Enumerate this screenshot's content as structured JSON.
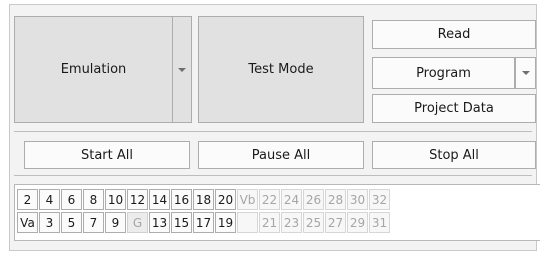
{
  "left_group": {
    "emulation_label": "Emulation",
    "test_mode_label": "Test Mode"
  },
  "right_group": {
    "read_label": "Read",
    "program_label": "Program",
    "project_data_label": "Project Data"
  },
  "actions": {
    "start_all_label": "Start All",
    "pause_all_label": "Pause All",
    "stop_all_label": "Stop All"
  },
  "pin_grid": {
    "row_top": [
      {
        "label": "2",
        "enabled": true
      },
      {
        "label": "4",
        "enabled": true
      },
      {
        "label": "6",
        "enabled": true
      },
      {
        "label": "8",
        "enabled": true
      },
      {
        "label": "10",
        "enabled": true
      },
      {
        "label": "12",
        "enabled": true
      },
      {
        "label": "14",
        "enabled": true
      },
      {
        "label": "16",
        "enabled": true
      },
      {
        "label": "18",
        "enabled": true
      },
      {
        "label": "20",
        "enabled": true
      },
      {
        "label": "Vb",
        "enabled": false
      },
      {
        "label": "22",
        "enabled": false
      },
      {
        "label": "24",
        "enabled": false
      },
      {
        "label": "26",
        "enabled": false
      },
      {
        "label": "28",
        "enabled": false
      },
      {
        "label": "30",
        "enabled": false
      },
      {
        "label": "32",
        "enabled": false
      }
    ],
    "row_bottom": [
      {
        "label": "Va",
        "enabled": true
      },
      {
        "label": "3",
        "enabled": true
      },
      {
        "label": "5",
        "enabled": true
      },
      {
        "label": "7",
        "enabled": true
      },
      {
        "label": "9",
        "enabled": true
      },
      {
        "label": "G",
        "enabled": false
      },
      {
        "label": "13",
        "enabled": true
      },
      {
        "label": "15",
        "enabled": true
      },
      {
        "label": "17",
        "enabled": true
      },
      {
        "label": "19",
        "enabled": true
      },
      {
        "label": "",
        "enabled": false
      },
      {
        "label": "21",
        "enabled": false
      },
      {
        "label": "23",
        "enabled": false
      },
      {
        "label": "25",
        "enabled": false
      },
      {
        "label": "27",
        "enabled": false
      },
      {
        "label": "29",
        "enabled": false
      },
      {
        "label": "31",
        "enabled": false
      }
    ]
  },
  "icons": {
    "dropdown": "chevron-down-icon"
  },
  "colors": {
    "panel_bg": "#f3f3f3",
    "big_button_bg": "#e1e1e1",
    "disabled_text": "#a6a6a6"
  }
}
